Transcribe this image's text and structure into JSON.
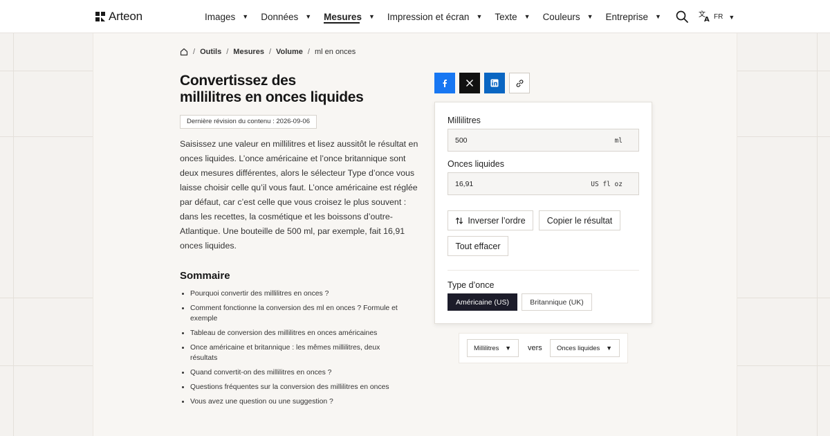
{
  "header": {
    "logo_text": "Arteon",
    "nav": [
      {
        "label": "Images"
      },
      {
        "label": "Données"
      },
      {
        "label": "Mesures",
        "active": true
      },
      {
        "label": "Impression et écran"
      },
      {
        "label": "Texte"
      },
      {
        "label": "Couleurs"
      },
      {
        "label": "Entreprise"
      }
    ],
    "lang": "FR",
    "caret": "▼"
  },
  "breadcrumb": {
    "items": [
      "Outils",
      "Mesures",
      "Volume"
    ],
    "current": "ml en onces",
    "sep": "/"
  },
  "page": {
    "title_line1": "Convertissez des",
    "title_line2": "millilitres en onces liquides",
    "revision": "Dernière révision du contenu : 2026-09-06",
    "intro": "Saisissez une valeur en millilitres et lisez aussitôt le résultat en onces liquides. L’once américaine et l’once britannique sont deux mesures différentes, alors le sélecteur Type d’once vous laisse choisir celle qu’il vous faut. L’once américaine est réglée par défaut, car c’est celle que vous croisez le plus souvent : dans les recettes, la cosmétique et les boissons d’outre-Atlantique. Une bouteille de 500 ml, par exemple, fait 16,91 onces liquides."
  },
  "toc": {
    "title": "Sommaire",
    "items": [
      "Pourquoi convertir des millilitres en onces ?",
      "Comment fonctionne la conversion des ml en onces ? Formule et exemple",
      "Tableau de conversion des millilitres en onces américaines",
      "Once américaine et britannique : les mêmes millilitres, deux résultats",
      "Quand convertit-on des millilitres en onces ?",
      "Questions fréquentes sur la conversion des millilitres en onces",
      "Vous avez une question ou une suggestion ?"
    ]
  },
  "converter": {
    "input_label": "Millilitres",
    "input_value": "500",
    "input_unit": "ml",
    "output_label": "Onces liquides",
    "output_value": "16,91",
    "output_unit": "US fl oz",
    "swap_label": "Inverser l’ordre",
    "copy_label": "Copier le résultat",
    "clear_label": "Tout effacer",
    "type_label": "Type d’once",
    "type_options": [
      "Américaine (US)",
      "Britannique (UK)"
    ],
    "type_selected": "Américaine (US)"
  },
  "unit_selector": {
    "from": "Millilitres",
    "to": "Onces liquides",
    "connector": "vers"
  },
  "colors": {
    "facebook": "#1877f2",
    "x": "#111111",
    "linkedin": "#0a66c2",
    "selected_segment": "#1c1c2a"
  },
  "icons": [
    "logo-icon",
    "search-icon",
    "translate-icon",
    "home-icon",
    "facebook-icon",
    "x-icon",
    "linkedin-icon",
    "link-icon",
    "swap-icon"
  ]
}
